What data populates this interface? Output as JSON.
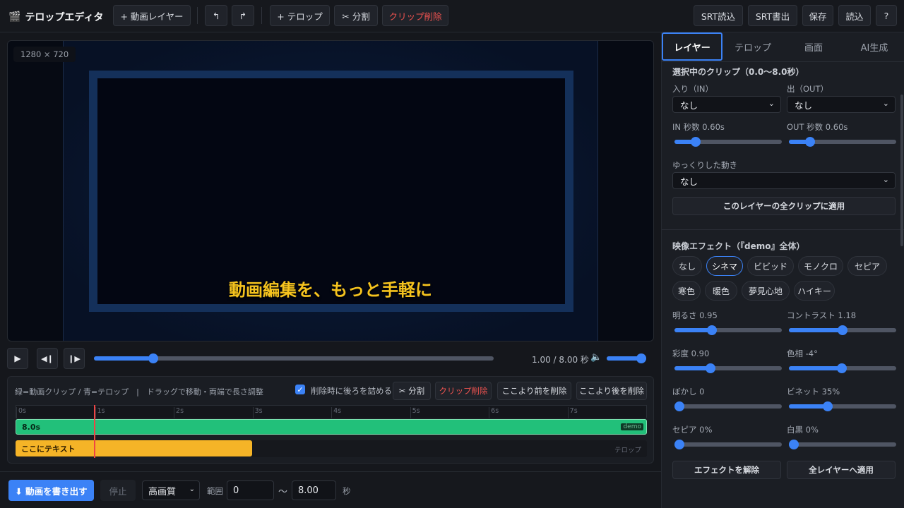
{
  "toolbar": {
    "title": "テロップエディタ",
    "add_layer": "+ 動画レイヤー",
    "undo": "↰",
    "redo": "↱",
    "add_telop": "+ テロップ",
    "split": "✂ 分割",
    "delete_clip": "クリップ削除",
    "srt_import": "SRT読込",
    "srt_export": "SRT書出",
    "save": "保存",
    "load": "読込",
    "help": "?"
  },
  "preview": {
    "resolution": "1280 × 720",
    "caption": "動画編集を、もっと手軽に"
  },
  "playback": {
    "time": "1.00 / 8.00 秒",
    "progress": 0.14,
    "volume": 1.0
  },
  "timeline": {
    "hint": "緑=動画クリップ / 青=テロップ　|　ドラッグで移動・両端で長さ調整",
    "ripple_label": "削除時に後ろを詰める",
    "ripple_checked": true,
    "split": "✂ 分割",
    "delete_clip": "クリップ削除",
    "delete_before": "ここより前を削除",
    "delete_after": "ここより後を削除",
    "ticks": [
      "0s",
      "1s",
      "2s",
      "3s",
      "4s",
      "5s",
      "6s",
      "7s"
    ],
    "duration": 8,
    "playhead": 1.0,
    "video_clip": {
      "label": "8.0s",
      "tag": "demo",
      "start": 0,
      "end": 8
    },
    "telop_clip": {
      "label": "ここにテキスト",
      "start": 0,
      "end": 3.0
    },
    "telop_track": "テロップ",
    "colors": {
      "video": "#22c07a",
      "telop": "#f5b427",
      "playhead": "#ef4444"
    }
  },
  "export": {
    "export_button": "⬇ 動画を書き出す",
    "stop": "停止",
    "quality": "高画質",
    "range_label": "範囲",
    "range_start": "0",
    "tilde": "〜",
    "range_end": "8.00",
    "seconds": "秒"
  },
  "panel": {
    "tabs": [
      "レイヤー",
      "テロップ",
      "画面",
      "AI生成"
    ],
    "active_tab": 0,
    "clip_section": {
      "title": "選択中のクリップ（0.0〜8.0秒）",
      "in_label": "入り（IN）",
      "out_label": "出（OUT）",
      "in_value": "なし",
      "out_value": "なし",
      "in_sec_label": "IN 秒数 0.60s",
      "out_sec_label": "OUT 秒数 0.60s",
      "in_sec": 0.17,
      "out_sec": 0.17,
      "motion_label": "ゆっくりした動き",
      "motion_value": "なし",
      "apply_all": "このレイヤーの全クリップに適用"
    },
    "effects": {
      "title": "映像エフェクト（『demo』全体）",
      "chips": [
        "なし",
        "シネマ",
        "ビビッド",
        "モノクロ",
        "セピア",
        "寒色",
        "暖色",
        "夢見心地",
        "ハイキー"
      ],
      "active_chip": 1,
      "sliders": [
        {
          "label": "明るさ 0.95",
          "value": 0.33
        },
        {
          "label": "コントラスト 1.18",
          "value": 0.5
        },
        {
          "label": "彩度 0.90",
          "value": 0.32
        },
        {
          "label": "色相 -4°",
          "value": 0.49
        },
        {
          "label": "ぼかし 0",
          "value": 0.0
        },
        {
          "label": "ビネット 35%",
          "value": 0.35
        },
        {
          "label": "セピア 0%",
          "value": 0.0
        },
        {
          "label": "白黒 0%",
          "value": 0.0
        }
      ],
      "reset": "エフェクトを解除",
      "apply_all_layers": "全レイヤーへ適用"
    }
  },
  "colors": {
    "accent": "#3b82f6",
    "danger": "#ef5350"
  }
}
